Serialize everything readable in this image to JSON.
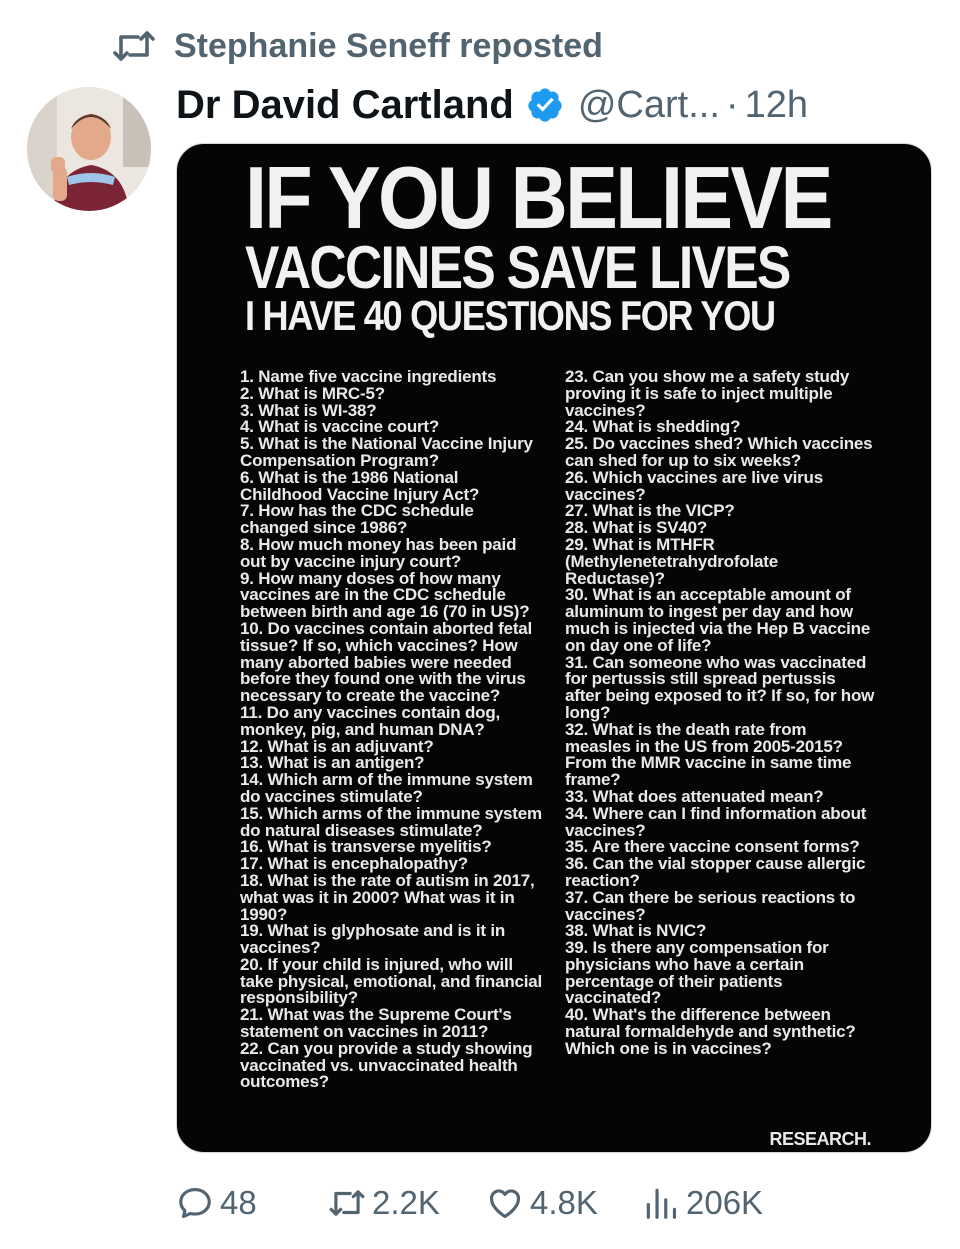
{
  "repost": {
    "label": "Stephanie Seneff reposted"
  },
  "author": {
    "name": "Dr David Cartland",
    "handle": "@Cart...",
    "separator": "·",
    "time": "12h",
    "verified_color": "#1d9bf0"
  },
  "image": {
    "heading1": "IF YOU BELIEVE",
    "heading2": "VACCINES SAVE LIVES",
    "heading3": "I HAVE 40 QUESTIONS FOR YOU",
    "questions_left": [
      "1. Name five vaccine ingredients",
      "2. What is MRC-5?",
      "3. What is WI-38?",
      "4. What is vaccine court?",
      "5. What is the National Vaccine Injury Compensation Program?",
      "6. What is the 1986 National Childhood Vaccine Injury Act?",
      "7. How has the CDC schedule changed since 1986?",
      "8. How much money has been paid out by vaccine injury court?",
      "9. How many doses of how many vaccines are in the CDC schedule between birth and age 16 (70 in US)?",
      "10. Do vaccines contain aborted fetal tissue? If so, which vaccines? How many aborted babies were needed before they found one with the virus necessary to create the vaccine?",
      "11. Do any vaccines contain dog, monkey, pig, and human DNA?",
      "12. What is an adjuvant?",
      "13. What is an antigen?",
      "14. Which arm of the immune system do vaccines stimulate?",
      "15. Which arms of the immune system do natural diseases stimulate?",
      "16. What is transverse myelitis?",
      "17. What is encephalopathy?",
      "18. What is the rate of autism in 2017, what was it in 2000? What was it in 1990?",
      "19. What is glyphosate and is it in vaccines?",
      "20. If your child is injured, who will take physical, emotional, and financial responsibility?",
      "21. What was the Supreme Court's statement on vaccines in 2011?",
      "22. Can you provide a study showing vaccinated vs. unvaccinated health outcomes?"
    ],
    "questions_right": [
      "23. Can you show me a safety study proving it is safe to inject multiple vaccines?",
      "24. What is shedding?",
      "25. Do vaccines shed? Which vaccines can shed for up to six weeks?",
      "26. Which vaccines are live virus vaccines?",
      "27. What is the VICP?",
      "28. What is SV40?",
      "29. What is MTHFR (Methylenetetrahydrofolate Reductase)?",
      "30. What is an acceptable amount of aluminum to ingest per day and how much is injected via the Hep B vaccine on day one of life?",
      "31. Can someone who was vaccinated for pertussis still spread pertussis after being exposed to it? If so, for how long?",
      "32. What is the death rate from measles in the US from 2005-2015? From the MMR vaccine in same time frame?",
      "33. What does attenuated mean?",
      "34. Where can I find information about vaccines?",
      "35. Are there vaccine consent forms?",
      "36. Can the vial stopper cause allergic reaction?",
      "37. Can there be serious reactions to vaccines?",
      "38. What is NVIC?",
      "39. Is there any compensation for physicians who have a certain percentage of their patients vaccinated?",
      "40. What's the difference between natural formaldehyde and synthetic? Which one is in vaccines?"
    ],
    "footer": "RESEARCH."
  },
  "actions": {
    "replies": "48",
    "reposts": "2.2K",
    "likes": "4.8K",
    "views": "206K",
    "icon_color": "#536471"
  }
}
